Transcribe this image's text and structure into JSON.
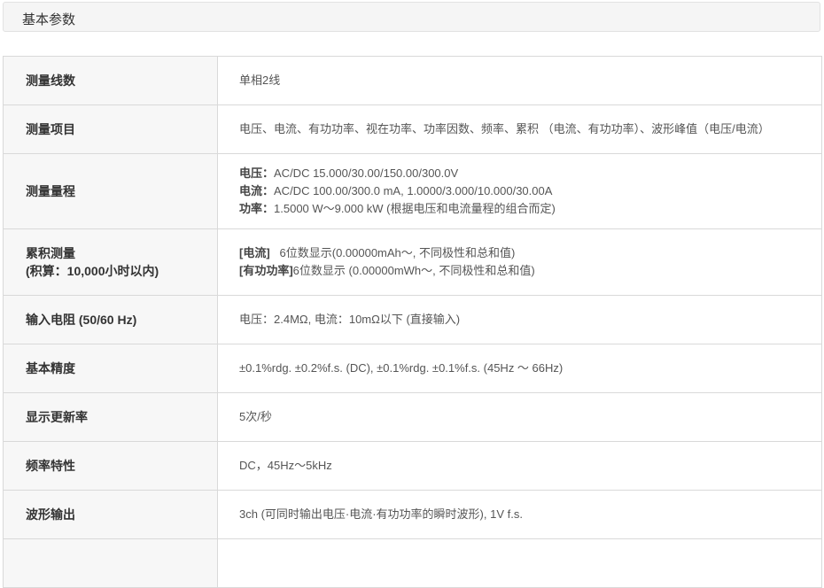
{
  "section": {
    "title": "基本参数"
  },
  "rows": [
    {
      "label": "测量线数",
      "value": "单相2线"
    },
    {
      "label": "测量项目",
      "value": "电压、电流、有功功率、视在功率、功率因数、频率、累积 （电流、有功功率）、波形峰值（电压/电流）"
    },
    {
      "label": "测量量程",
      "lines": [
        {
          "key": "电压：",
          "text": "AC/DC 15.000/30.00/150.00/300.0V"
        },
        {
          "key": "电流：",
          "text": "AC/DC 100.00/300.0 mA, 1.0000/3.000/10.000/30.00A"
        },
        {
          "key": "功率：",
          "text": "1.5000 W～9.000 kW (根据电压和电流量程的组合而定)"
        }
      ]
    },
    {
      "label_line1": "累积测量",
      "label_line2": "(积算：10,000小时以内)",
      "lines": [
        {
          "key": "[电流]",
          "text": "   6位数显示(0.00000mAh～, 不同极性和总和值)"
        },
        {
          "key": "[有功功率]",
          "text": "6位数显示 (0.00000mWh～, 不同极性和总和值)"
        }
      ]
    },
    {
      "label": "输入电阻 (50/60 Hz)",
      "value": "电压：2.4MΩ, 电流：10mΩ以下 (直接输入)"
    },
    {
      "label": "基本精度",
      "value": "±0.1%rdg. ±0.2%f.s. (DC), ±0.1%rdg. ±0.1%f.s. (45Hz ～ 66Hz)"
    },
    {
      "label": "显示更新率",
      "value": "5次/秒"
    },
    {
      "label": "频率特性",
      "value": "DC，45Hz～5kHz"
    },
    {
      "label": "波形输出",
      "value": "3ch (可同时输出电压·电流·有功功率的瞬时波形), 1V f.s."
    }
  ]
}
